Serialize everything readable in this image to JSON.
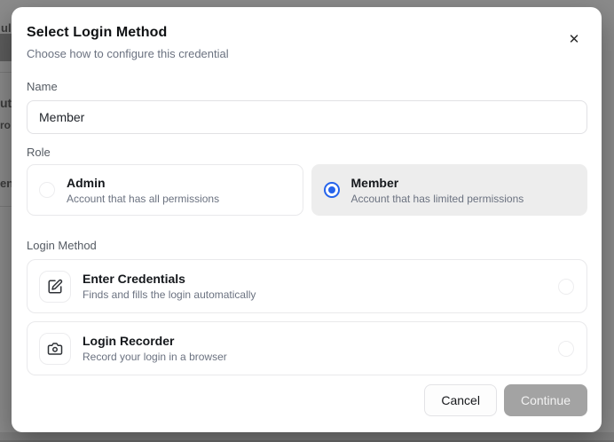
{
  "backdrop": {
    "fragments": {
      "f1": "ul",
      "f2": "ut",
      "f3": "ro",
      "f4": "en"
    }
  },
  "modal": {
    "title": "Select Login Method",
    "subtitle": "Choose how to configure this credential",
    "close_glyph": "✕"
  },
  "name_field": {
    "label": "Name",
    "value": "Member"
  },
  "role": {
    "label": "Role",
    "options": [
      {
        "title": "Admin",
        "description": "Account that has all permissions",
        "selected": false
      },
      {
        "title": "Member",
        "description": "Account that has limited permissions",
        "selected": true
      }
    ]
  },
  "login_method": {
    "label": "Login Method",
    "options": [
      {
        "title": "Enter Credentials",
        "description": "Finds and fills the login automatically",
        "icon": "edit-icon",
        "selected": false
      },
      {
        "title": "Login Recorder",
        "description": "Record your login in a browser",
        "icon": "camera-icon",
        "selected": false
      }
    ]
  },
  "footer": {
    "cancel_label": "Cancel",
    "continue_label": "Continue"
  },
  "colors": {
    "accent": "#2563eb",
    "selected_card_bg": "#ededed",
    "overlay": "#8b8b8b",
    "continue_disabled_bg": "#a3a3a3"
  }
}
